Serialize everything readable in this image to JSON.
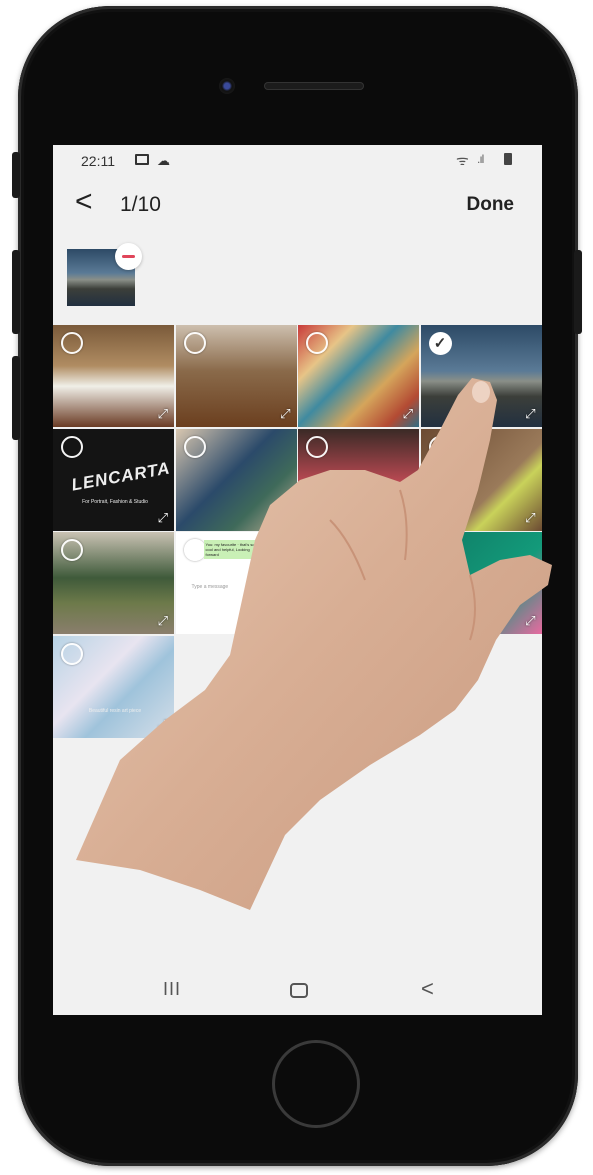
{
  "status_bar": {
    "time": "22:11",
    "icons": [
      "image-icon",
      "cloud-icon",
      "wifi-icon",
      "signal-icon",
      "battery-icon"
    ]
  },
  "header": {
    "back_glyph": "<",
    "counter": "1/10",
    "done_label": "Done"
  },
  "selected_strip": {
    "items": [
      {
        "name": "coastline-photo",
        "selected": true
      }
    ]
  },
  "grid": {
    "tiles": [
      {
        "name": "plant-on-stand",
        "selected": false,
        "bg": "linear-gradient(180deg,#7a5a3a 0%,#b08c62 40%,#f0efe8 60%,#6a3b24 100%)"
      },
      {
        "name": "wooden-floor-room",
        "selected": false,
        "bg": "linear-gradient(180deg,#cdbfae 0%,#8a6a4a 45%,#6b3f1f 100%)"
      },
      {
        "name": "checkered-pillow",
        "selected": false,
        "bg": "linear-gradient(135deg,#c83a3a 0%,#e7c487 25%,#3f8aa0 45%,#d5a55b 65%,#b34a33 85%,#2f6d84 100%)"
      },
      {
        "name": "coastline-photo",
        "selected": true,
        "bg": "linear-gradient(180deg,#2d4a66 0%,#5a7a96 45%,#8a8f88 55%,#3c3f3a 70%,#223040 100%)"
      },
      {
        "name": "black-bag-logo",
        "selected": false,
        "bg": "#141414",
        "logo": "LENCARTA",
        "caption": "For Portrait, Fashion & Studio"
      },
      {
        "name": "painting-on-wall",
        "selected": false,
        "bg": "linear-gradient(135deg,#d9c7b0 0%,#2b4a6a 45%,#3f6a5a 70%,#c8b59b 100%)"
      },
      {
        "name": "red-light-room",
        "selected": false,
        "bg": "linear-gradient(180deg,#3a2a26 0%,#c24b55 55%,#5a3a30 100%)"
      },
      {
        "name": "tennis-ball",
        "selected": false,
        "bg": "linear-gradient(135deg,#6b4a32 0%,#9a7a5a 60%,#c9d25a 70%,#6b4a32 100%)"
      },
      {
        "name": "snake-plant",
        "selected": false,
        "bg": "linear-gradient(180deg,#c9c2b3 0%,#3f5a3a 45%,#6d7a4a 70%,#8a7e6d 100%)"
      },
      {
        "name": "chat-screenshot",
        "selected": false,
        "bg": "#ffffff",
        "chat_text": "You: my favourite · that's so cool and helpful, Looking forward",
        "input_placeholder": "Type a message"
      },
      {
        "name": "hidden-photo",
        "selected": false,
        "bg": "#c9c2b3"
      },
      {
        "name": "green-towel",
        "selected": false,
        "bg": "linear-gradient(135deg,#0f7a64 0%,#139a7a 60%,#e86aa0 100%)"
      },
      {
        "name": "marble-art",
        "selected": false,
        "bg": "linear-gradient(135deg,#b7d3e5 0%,#e8e4f0 40%,#9fc3db 60%,#d6dfe9 100%)",
        "caption": "Beautiful resin art piece"
      }
    ]
  },
  "nav_bar": {
    "recent_glyph": "III",
    "back_glyph": "<"
  }
}
